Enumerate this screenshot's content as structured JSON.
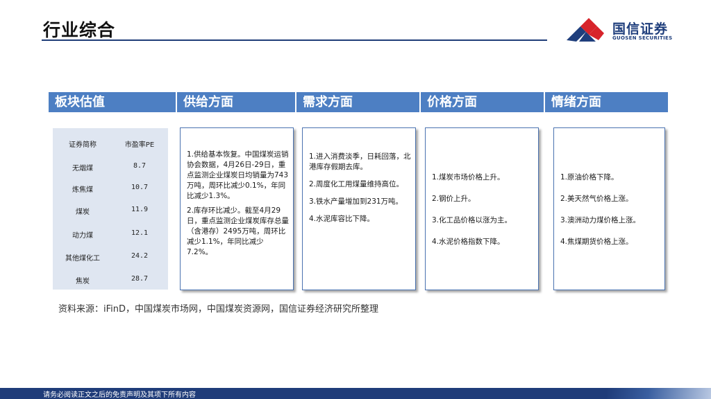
{
  "page": {
    "title": "行业综合",
    "logo": {
      "cn": "国信证券",
      "en": "GUOSEN SECURITIES"
    },
    "source": "资料来源：iFinD，中国煤炭市场网，中国煤炭资源网，国信证券经济研究所整理",
    "footer": "请务必阅读正文之后的免责声明及其项下所有内容"
  },
  "colors": {
    "header_bg": "#4d7fc3",
    "brand_blue": "#1f3e7c",
    "brand_red": "#d7242b",
    "table_bg": "#dfe6f1"
  },
  "headers": [
    "板块估值",
    "供给方面",
    "需求方面",
    "价格方面",
    "情绪方面"
  ],
  "valuation": {
    "columns": [
      "证券简称",
      "市盈率PE"
    ],
    "rows": [
      [
        "无烟煤",
        "8.7"
      ],
      [
        "炼焦煤",
        "10.7"
      ],
      [
        "煤炭",
        "11.9"
      ],
      [
        "动力煤",
        "12.1"
      ],
      [
        "其他煤化工",
        "24.2"
      ],
      [
        "焦炭",
        "28.7"
      ]
    ]
  },
  "supply": [
    "1.供给基本恢复。中国煤炭运销协会数据，4月26日-29日，重点监测企业煤炭日均销量为743万吨，周环比减少0.1%，年同比减少1.3%。",
    "2.库存环比减少。截至4月29日，重点监测企业煤炭库存总量（含港存）2495万吨，周环比减少1.1%，年同比减少7.2%。"
  ],
  "demand": [
    "1.进入消费淡季，日耗回落，北港库存假期去库。",
    "2.周度化工用煤量维持高位。",
    "3.铁水产量增加到231万吨。",
    "4.水泥库容比下降。"
  ],
  "price": [
    "1.煤炭市场价格上升。",
    "2.钢价上升。",
    "3.化工品价格以涨为主。",
    "4.水泥价格指数下降。"
  ],
  "sentiment": [
    "1.原油价格下降。",
    "2.美天然气价格上涨。",
    "3.澳洲动力煤价格上涨。",
    "4.焦煤期货价格上涨。"
  ]
}
